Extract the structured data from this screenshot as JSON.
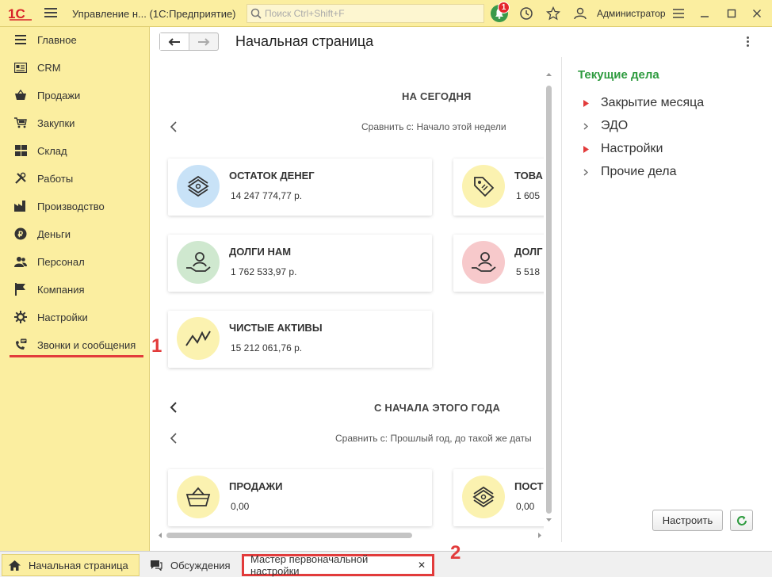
{
  "topbar": {
    "app_title": "Управление н...  (1С:Предприятие)",
    "search_placeholder": "Поиск Ctrl+Shift+F",
    "notification_count": "1",
    "user": "Администратор"
  },
  "sidebar": {
    "items": [
      {
        "label": "Главное",
        "icon": "menu-lines-icon"
      },
      {
        "label": "CRM",
        "icon": "crm-card-icon"
      },
      {
        "label": "Продажи",
        "icon": "basket-icon"
      },
      {
        "label": "Закупки",
        "icon": "cart-icon"
      },
      {
        "label": "Склад",
        "icon": "warehouse-icon"
      },
      {
        "label": "Работы",
        "icon": "tools-icon"
      },
      {
        "label": "Производство",
        "icon": "factory-icon"
      },
      {
        "label": "Деньги",
        "icon": "coin-icon"
      },
      {
        "label": "Персонал",
        "icon": "people-icon"
      },
      {
        "label": "Компания",
        "icon": "flag-icon"
      },
      {
        "label": "Настройки",
        "icon": "gear-icon"
      },
      {
        "label": "Звонки и сообщения",
        "icon": "phone-message-icon"
      }
    ],
    "marker": "1"
  },
  "header": {
    "title": "Начальная страница"
  },
  "dashboard": {
    "today_title": "НА СЕГОДНЯ",
    "today_compare": "Сравнить с: Начало этой недели",
    "cards_today": [
      {
        "title": "ОСТАТОК ДЕНЕГ",
        "value": "14 247 774,77 р.",
        "color": "#c8e2f7"
      },
      {
        "title": "ТОВА",
        "value": "1 605",
        "color": "#fbf2b0"
      },
      {
        "title": "ДОЛГИ НАМ",
        "value": "1 762 533,97 р.",
        "color": "#cfe8cf"
      },
      {
        "title": "ДОЛГ",
        "value": "5 518",
        "color": "#f7c9cb"
      },
      {
        "title": "ЧИСТЫЕ АКТИВЫ",
        "value": "15 212 061,76 р.",
        "color": "#fbf2b0"
      }
    ],
    "year_title": "С НАЧАЛА ЭТОГО ГОДА",
    "year_compare": "Сравнить с: Прошлый год, до такой же даты",
    "cards_year": [
      {
        "title": "ПРОДАЖИ",
        "value": "0,00",
        "color": "#fbf2b0"
      },
      {
        "title": "ПОСТ",
        "value": "0,00",
        "color": "#fbf2b0"
      }
    ]
  },
  "right_panel": {
    "title": "Текущие дела",
    "tasks": [
      {
        "label": "Закрытие месяца",
        "marker": "red"
      },
      {
        "label": "ЭДО",
        "marker": "gray"
      },
      {
        "label": "Настройки",
        "marker": "red"
      },
      {
        "label": "Прочие дела",
        "marker": "gray"
      }
    ],
    "configure_button": "Настроить"
  },
  "bottom_tabs": [
    {
      "label": "Начальная страница",
      "icon": "home-icon"
    },
    {
      "label": "Обсуждения",
      "icon": "chat-icon"
    },
    {
      "label": "Мастер первоначальной настройки",
      "icon": ""
    }
  ],
  "bottom_marker": "2",
  "colors": {
    "accent_yellow": "#fbeea0",
    "green_title": "#2e9b3f",
    "annotation_red": "#e23b3b"
  }
}
